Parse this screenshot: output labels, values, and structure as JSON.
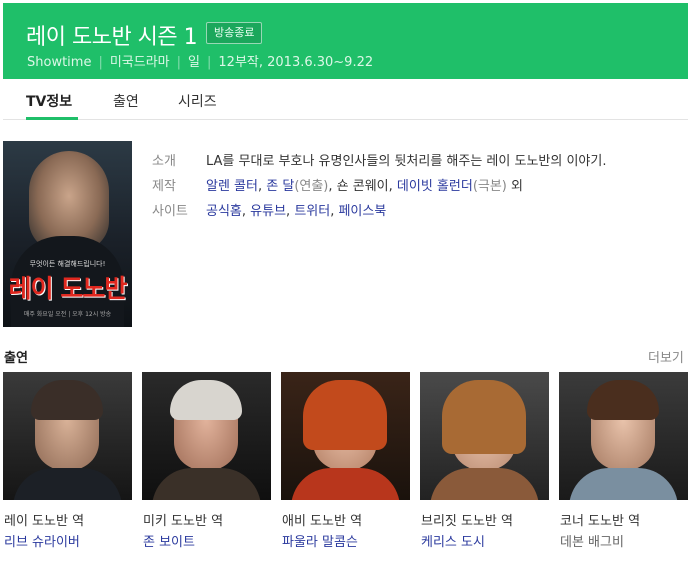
{
  "header": {
    "title": "레이 도노반 시즌 1",
    "badge": "방송종료",
    "network": "Showtime",
    "genre": "미국드라마",
    "day": "일",
    "episodes_dates": "12부작, 2013.6.30~9.22"
  },
  "tabs": [
    {
      "label": "TV정보",
      "active": true
    },
    {
      "label": "출연",
      "active": false
    },
    {
      "label": "시리즈",
      "active": false
    }
  ],
  "poster": {
    "tagline": "무엇이든 해결해드립니다!",
    "title": "레이 도노반",
    "credit": "매주 화요일 오전 | 오후 12시 방송"
  },
  "info": {
    "intro_label": "소개",
    "intro_text": "LA를 무대로 부호나 유명인사들의 뒷처리를 해주는 레이 도노반의 이야기.",
    "production_label": "제작",
    "production": {
      "person1": "알렌 콜터",
      "person2": "존 달",
      "role2": "(연출)",
      "person3": "숀 콘웨이",
      "person4": "데이빗 홀런더",
      "role4": "(극본)",
      "suffix": "외"
    },
    "site_label": "사이트",
    "sites": [
      "공식홈",
      "유튜브",
      "트위터",
      "페이스북"
    ]
  },
  "cast": {
    "section_title": "출연",
    "more_label": "더보기",
    "members": [
      {
        "role": "레이 도노반 역",
        "actor": "리브 슈라이버",
        "linked": true
      },
      {
        "role": "미키 도노반 역",
        "actor": "존 보이트",
        "linked": true
      },
      {
        "role": "애비 도노반 역",
        "actor": "파울라 말콤슨",
        "linked": true
      },
      {
        "role": "브리짓 도노반 역",
        "actor": "케리스 도시",
        "linked": true
      },
      {
        "role": "코너 도노반 역",
        "actor": "데본 배그비",
        "linked": false
      }
    ]
  },
  "colors": {
    "brand_green": "#1fbf69",
    "link_blue": "#2b3a9e",
    "poster_title_red": "#e0281f"
  }
}
